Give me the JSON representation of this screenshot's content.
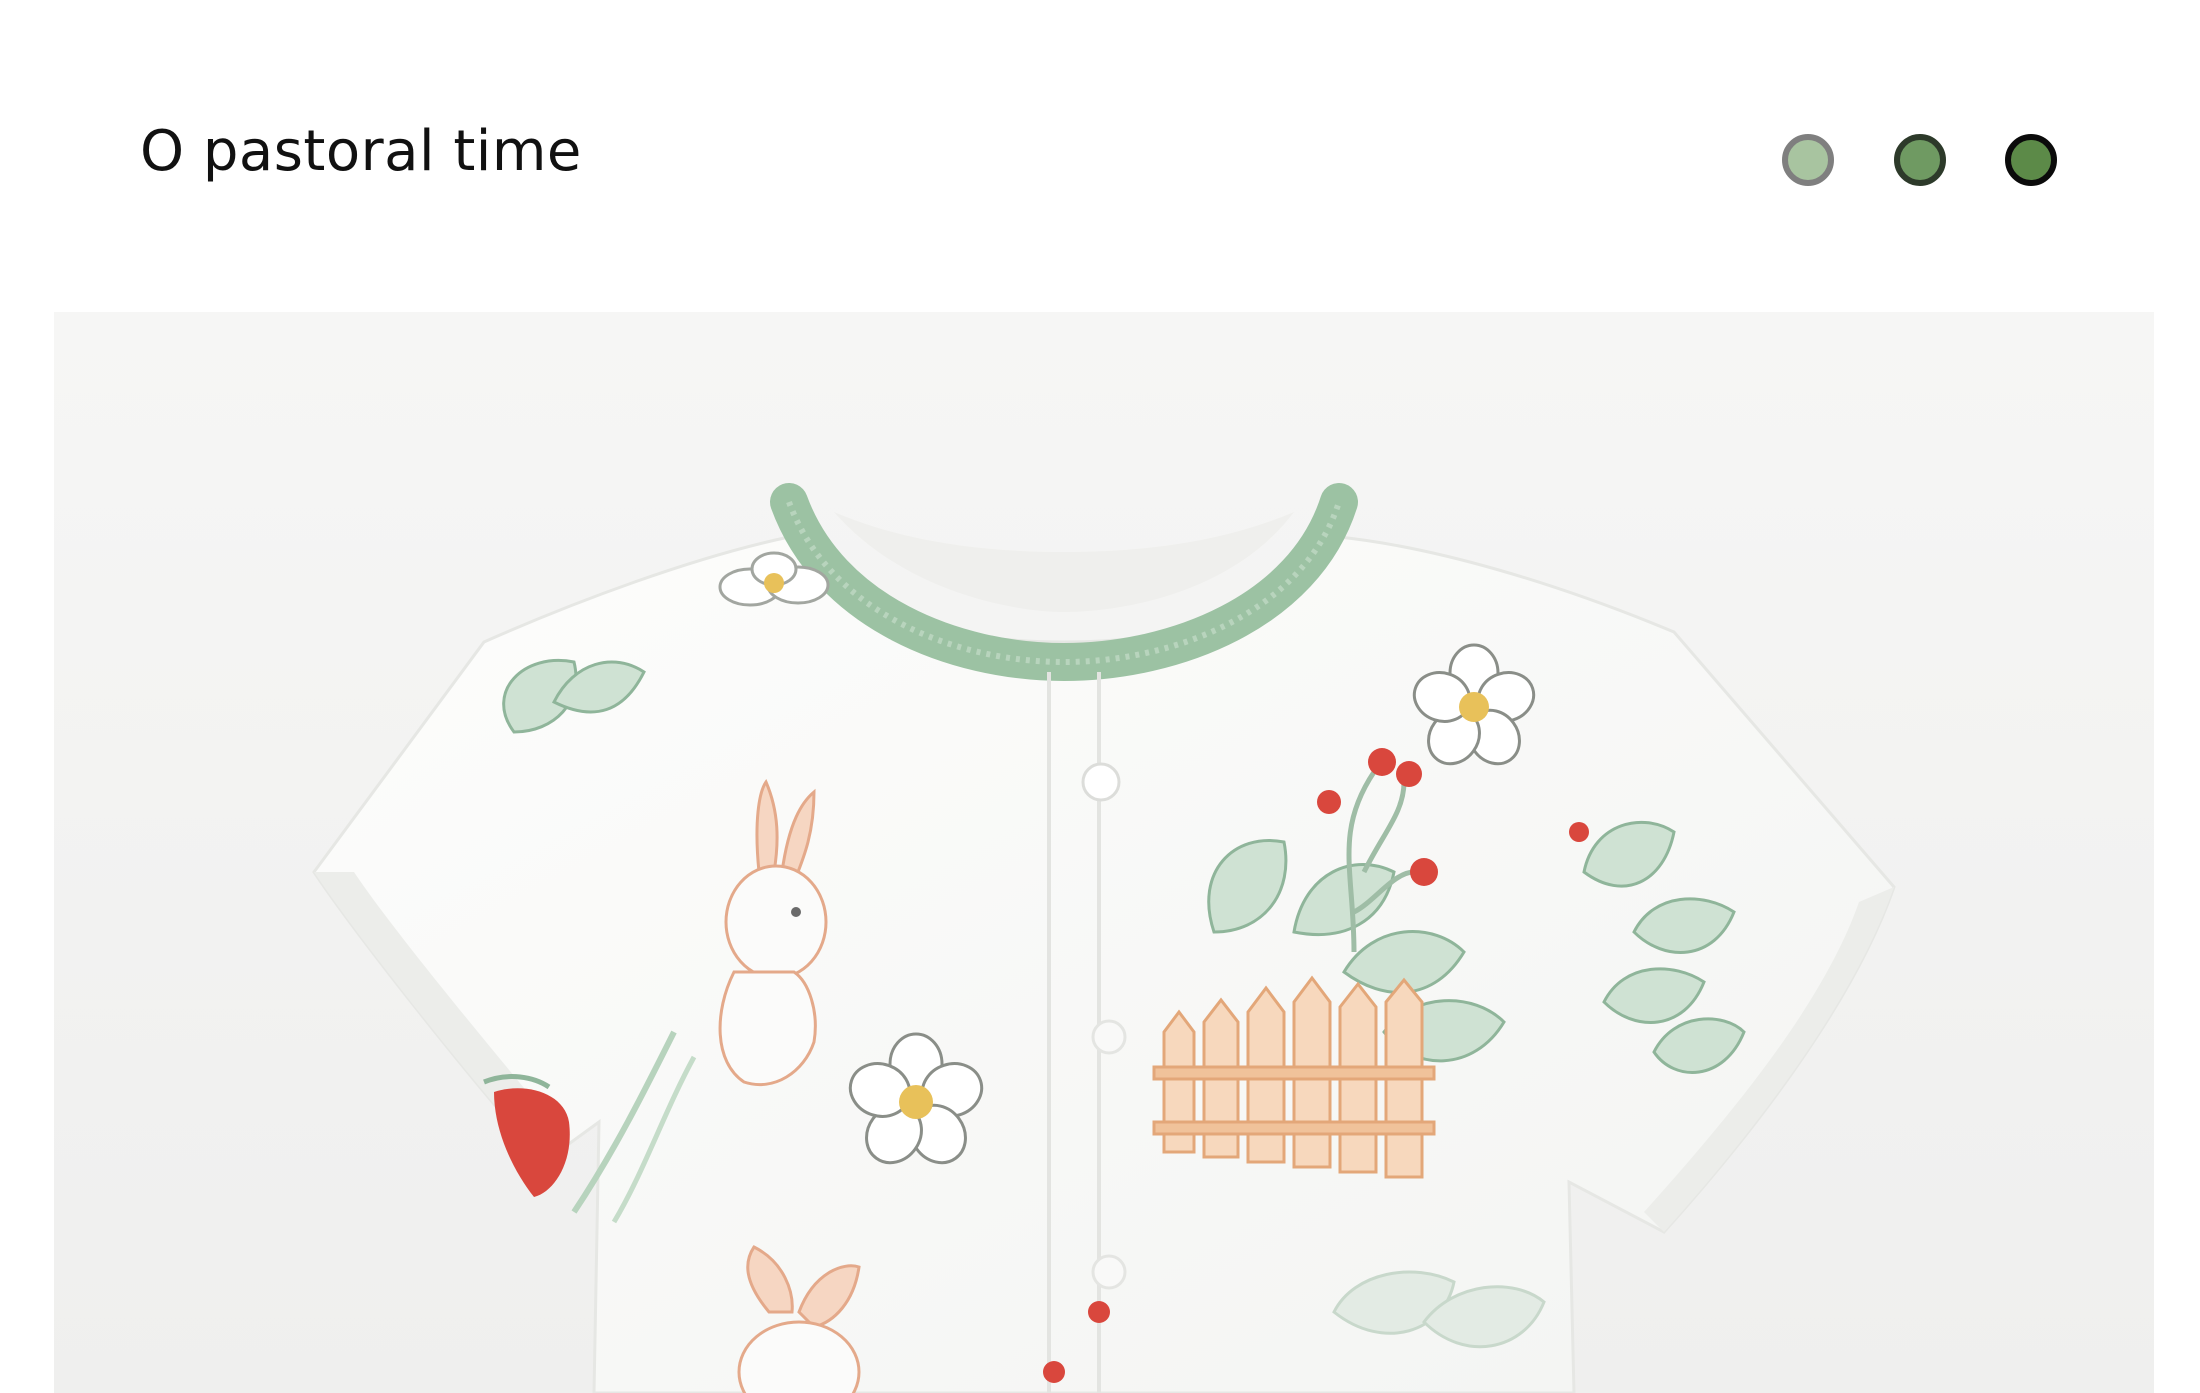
{
  "header": {
    "title": "O pastoral time"
  },
  "color_options": [
    {
      "name": "light-green",
      "color": "#a8c4a0",
      "ring": "#7f7f7f"
    },
    {
      "name": "medium-green",
      "color": "#6f9a62",
      "ring": "#2d3a2a"
    },
    {
      "name": "dark-green",
      "color": "#5c8a48",
      "ring": "#0b0b0b"
    }
  ],
  "product_image": {
    "description_icon": "baby-romper-photo",
    "palette": {
      "background": "#f4f4f3",
      "garment": "#fbfbfa",
      "collar": "#9cc2a3",
      "leaf": "#b7d3bd",
      "berry": "#d9473d",
      "fence": "#f0c29a",
      "rabbit": "#f2c7a6",
      "flower_center": "#e8c15a"
    }
  }
}
